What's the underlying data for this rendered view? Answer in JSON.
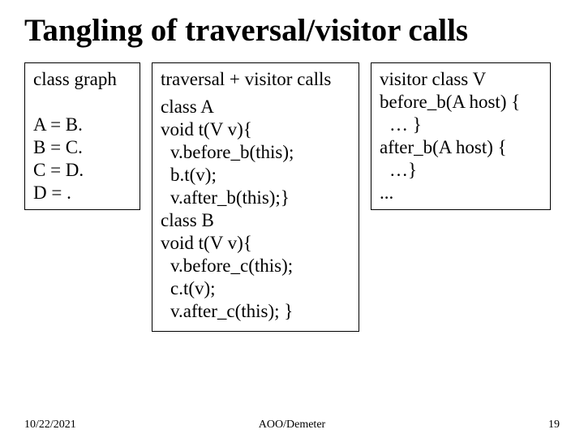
{
  "slide": {
    "title": "Tangling of traversal/visitor calls",
    "left": {
      "header": "class graph",
      "l1": "A = B.",
      "l2": "B = C.",
      "l3": "C = D.",
      "l4": "D = ."
    },
    "mid": {
      "header": "traversal + visitor calls",
      "l1": "class A",
      "l2": "void t(V v){",
      "l3": "v.before_b(this);",
      "l4": "b.t(v);",
      "l5": "v.after_b(this);}",
      "l6": "class B",
      "l7": "void t(V v){",
      "l8": "v.before_c(this);",
      "l9": "c.t(v);",
      "l10": "v.after_c(this); }"
    },
    "right": {
      "l1": "visitor class V",
      "l2": "before_b(A host) {",
      "l3": "… }",
      "l4": "after_b(A host) {",
      "l5": "…}",
      "l6": "..."
    },
    "footer": {
      "date": "10/22/2021",
      "center": "AOO/Demeter",
      "page": "19"
    }
  }
}
